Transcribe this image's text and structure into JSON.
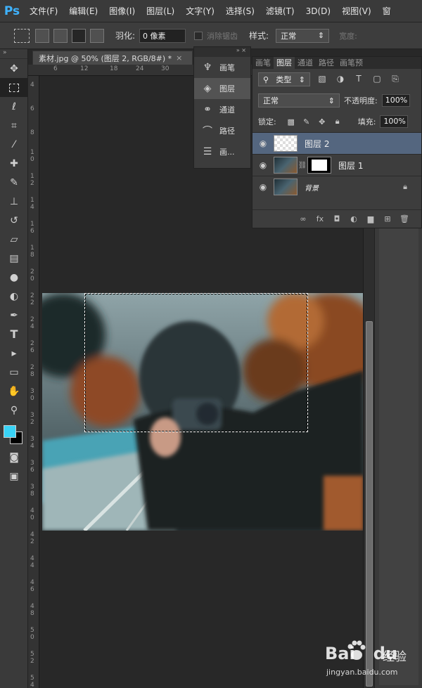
{
  "app": {
    "logo": "Ps"
  },
  "menu": [
    "文件(F)",
    "编辑(E)",
    "图像(I)",
    "图层(L)",
    "文字(Y)",
    "选择(S)",
    "滤镜(T)",
    "3D(D)",
    "视图(V)",
    "窗"
  ],
  "options": {
    "feather_label": "羽化:",
    "feather_value": "0 像素",
    "antialias_label": "消除锯齿",
    "style_label": "样式:",
    "style_value": "正常",
    "width_label": "宽度:"
  },
  "document": {
    "tab_title": "素材.jpg @ 50% (图层 2, RGB/8#) *",
    "close": "×",
    "ruler_top": [
      "6",
      "12",
      "18",
      "24",
      "30"
    ],
    "ruler_left": [
      "4",
      "6",
      "8",
      "1 0",
      "1 2",
      "1 4",
      "1 6",
      "1 8",
      "2 0",
      "2 2",
      "2 4",
      "2 6",
      "2 8",
      "3 0",
      "3 2",
      "3 4",
      "3 6",
      "3 8",
      "4 0",
      "4 2",
      "4 4",
      "4 6",
      "4 8",
      "5 0",
      "5 2",
      "5 4"
    ]
  },
  "tools": [
    "move-tool",
    "marquee-tool",
    "lasso-tool",
    "crop-tool",
    "eyedropper-tool",
    "healing-tool",
    "brush-tool",
    "stamp-tool",
    "history-brush-tool",
    "eraser-tool",
    "gradient-tool",
    "blur-tool",
    "dodge-tool",
    "pen-tool",
    "type-tool",
    "path-select-tool",
    "shape-tool",
    "hand-tool",
    "zoom-tool"
  ],
  "colors": {
    "foreground": "#39d3f6",
    "background": "#000000",
    "selected_layer": "#54667f"
  },
  "collapsed_panels": [
    {
      "icon": "brush-icon",
      "label": "画笔"
    },
    {
      "icon": "layers-icon",
      "label": "图层"
    },
    {
      "icon": "channels-icon",
      "label": "通道"
    },
    {
      "icon": "paths-icon",
      "label": "路径"
    },
    {
      "icon": "adjust-icon",
      "label": "画..."
    }
  ],
  "layers_panel": {
    "tabs": [
      "画笔",
      "图层",
      "通道",
      "路径",
      "画笔预"
    ],
    "kind_filter": "类型",
    "blend_mode": "正常",
    "opacity_label": "不透明度:",
    "opacity_value": "100%",
    "lock_label": "锁定:",
    "fill_label": "填充:",
    "fill_value": "100%",
    "layers": [
      {
        "name": "图层 2",
        "selected": true
      },
      {
        "name": "图层 1",
        "selected": false
      },
      {
        "name": "背景",
        "selected": false
      }
    ]
  },
  "watermark": {
    "brand": "Bai",
    "brand2": "du",
    "suffix": "经验",
    "url": "jingyan.baidu.com"
  }
}
